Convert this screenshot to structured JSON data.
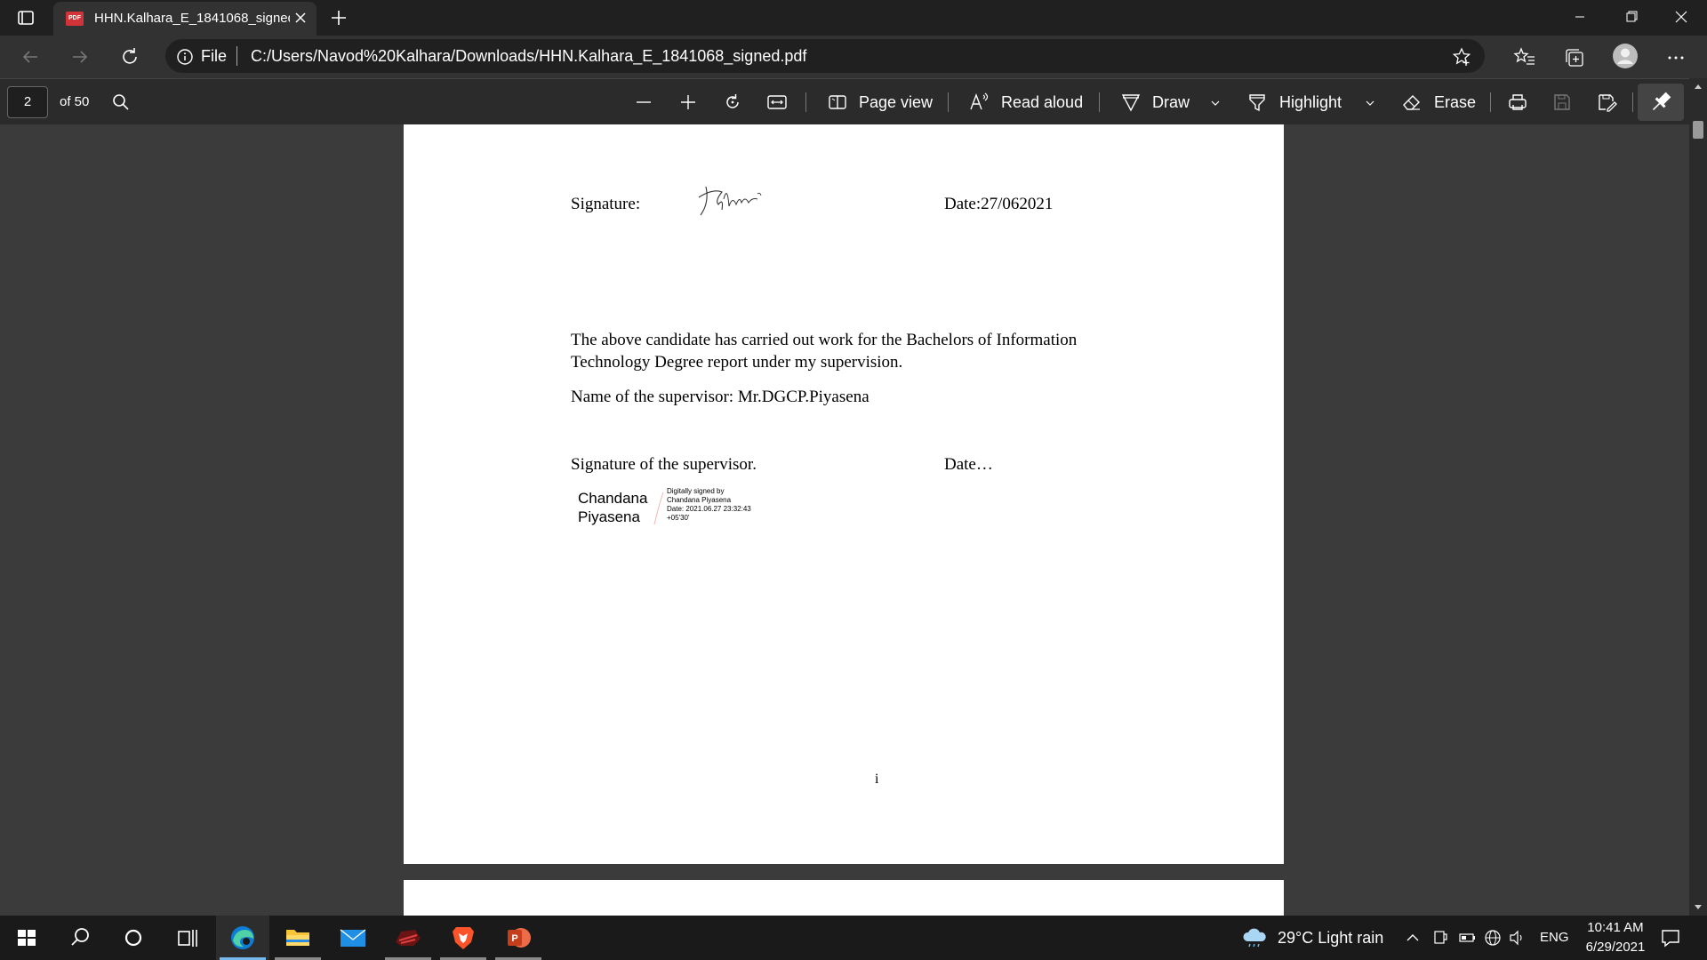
{
  "browser": {
    "tab_title": "HHN.Kalhara_E_1841068_signed.pdf",
    "tab_icon_text": "PDF",
    "address_prefix": "File",
    "url": "C:/Users/Navod%20Kalhara/Downloads/HHN.Kalhara_E_1841068_signed.pdf"
  },
  "pdf_toolbar": {
    "current_page": "2",
    "page_count": "of 50",
    "page_view_label": "Page view",
    "read_aloud_label": "Read aloud",
    "draw_label": "Draw",
    "highlight_label": "Highlight",
    "erase_label": "Erase"
  },
  "document": {
    "signature_label": "Signature:",
    "handwritten_signature": "Kalhara",
    "date_1": "Date:27/062021",
    "paragraph_line1": "The above candidate has carried out work for the Bachelors of Information",
    "paragraph_line2": "Technology Degree report under my supervision.",
    "supervisor_name": "Name of the supervisor: Mr.DGCP.Piyasena",
    "supervisor_signature_label": "Signature of the supervisor.",
    "date_2": "Date…",
    "digital_signer_line1": "Chandana",
    "digital_signer_line2": "Piyasena",
    "digital_sig_info_1": "Digitally signed by",
    "digital_sig_info_2": "Chandana Piyasena",
    "digital_sig_info_3": "Date: 2021.06.27 23:32:43",
    "digital_sig_info_4": "+05'30'",
    "page_number": "i"
  },
  "taskbar": {
    "weather": "29°C  Light rain",
    "language": "ENG",
    "time": "10:41 AM",
    "date": "6/29/2021"
  },
  "colors": {
    "edge_blue": "#0c7cd5",
    "pdf_red": "#d13438",
    "brave_orange": "#fb542b",
    "powerpoint_red": "#c43e1c",
    "explorer_yellow": "#f8c43a"
  }
}
